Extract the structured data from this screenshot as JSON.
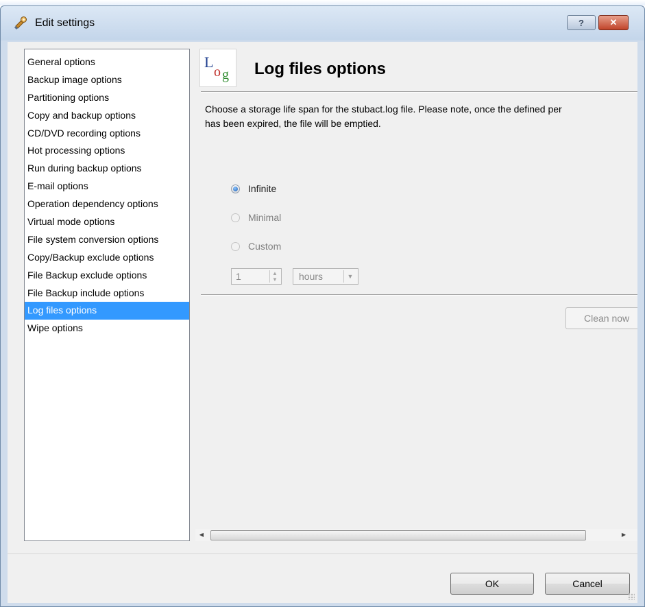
{
  "window": {
    "title": "Edit settings",
    "help_label": "?",
    "close_label": "✕"
  },
  "nav": {
    "items": [
      {
        "label": "General options",
        "selected": false
      },
      {
        "label": "Backup image options",
        "selected": false
      },
      {
        "label": "Partitioning options",
        "selected": false
      },
      {
        "label": "Copy and backup options",
        "selected": false
      },
      {
        "label": "CD/DVD recording options",
        "selected": false
      },
      {
        "label": "Hot processing options",
        "selected": false
      },
      {
        "label": "Run during backup options",
        "selected": false
      },
      {
        "label": "E-mail options",
        "selected": false
      },
      {
        "label": "Operation dependency options",
        "selected": false
      },
      {
        "label": "Virtual mode options",
        "selected": false
      },
      {
        "label": "File system conversion options",
        "selected": false
      },
      {
        "label": "Copy/Backup exclude options",
        "selected": false
      },
      {
        "label": "File Backup exclude options",
        "selected": false
      },
      {
        "label": "File Backup include options",
        "selected": false
      },
      {
        "label": "Log files options",
        "selected": true
      },
      {
        "label": "Wipe options",
        "selected": false
      }
    ]
  },
  "panel": {
    "logo_text": "Log",
    "title": "Log files options",
    "description_line1": "Choose a storage life span for the stubact.log file. Please note, once the defined per",
    "description_line2": "has been expired, the file will be emptied.",
    "options": {
      "infinite": {
        "label": "Infinite",
        "checked": true
      },
      "minimal": {
        "label": "Minimal",
        "checked": false
      },
      "custom": {
        "label": "Custom",
        "checked": false
      }
    },
    "custom_value": "1",
    "custom_unit": "hours",
    "clean_now_label": "Clean now"
  },
  "footer": {
    "ok_label": "OK",
    "cancel_label": "Cancel"
  },
  "colors": {
    "selection": "#3399ff",
    "dialog_bg": "#f0f0f0",
    "frame": "#cfdcec"
  }
}
